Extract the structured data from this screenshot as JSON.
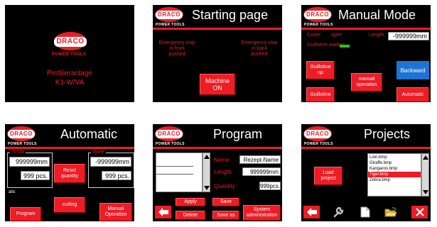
{
  "brand": {
    "logo_text": "DRACO",
    "logo_subtitle": "POWER TOOLS"
  },
  "panels": {
    "splash": {
      "line1": "Profilieranlage",
      "line2": "K1-W/VA"
    },
    "starting": {
      "title": "Starting page",
      "estop_front": [
        "Emergency stop",
        "in front",
        "pushed"
      ],
      "estop_back": [
        "Emergency stop",
        "in back",
        "pushed"
      ],
      "machine_btn": [
        "Machine",
        "ON"
      ]
    },
    "manual": {
      "title": "Manual Mode",
      "cover_label": "Cover:",
      "cover_value": "open",
      "length_label": "Length:",
      "length_value": "-999999mm",
      "guillotine_label": "Guillotine waiting...",
      "btn_guillotine_up": [
        "Guillotine",
        "up"
      ],
      "btn_backward": "Backward",
      "btn_manual_operation": [
        "manual",
        "operation"
      ],
      "btn_guillotine": "Guillotine",
      "btn_automatic": "Automatic"
    },
    "automatic": {
      "title": "Automatic",
      "todo_label": "To Do",
      "done_label": "Done",
      "todo_length": "999999mm",
      "todo_pcs": "999 pcs.",
      "done_length": "-999999mm",
      "done_pcs": "999 pcs.",
      "btn_reset_quantity": [
        "Reset",
        "quantity"
      ],
      "abc_text": "abc",
      "btn_cutting": "cutting",
      "btn_program": "Program",
      "btn_manual_operation": [
        "Manual",
        "Operation"
      ]
    },
    "program": {
      "title": "Program",
      "name_label": "Name:",
      "name_value": "Rezept-Name",
      "length_label": "Length:",
      "length_value": "999999mm",
      "quantity_label": "Quantity:",
      "quantity_value": "999pcs.",
      "btn_apply": "Apply",
      "btn_save": "Save",
      "btn_delete": "Delete",
      "btn_save_as": "Save as",
      "btn_sys_admin": [
        "System",
        "administration"
      ]
    },
    "projects": {
      "title": "Projects",
      "btn_load_project": [
        "Load",
        "project"
      ],
      "files": [
        "Lion.bmp",
        "Giraffe.bmp",
        "Kangaroo.bmp",
        "Tiger.bmp",
        "Zebra.bmp"
      ],
      "selected_index": 3
    }
  },
  "colors": {
    "accent_red": "#ee1c25",
    "blue_button": "#1e73d6",
    "status_green": "#22c522"
  }
}
